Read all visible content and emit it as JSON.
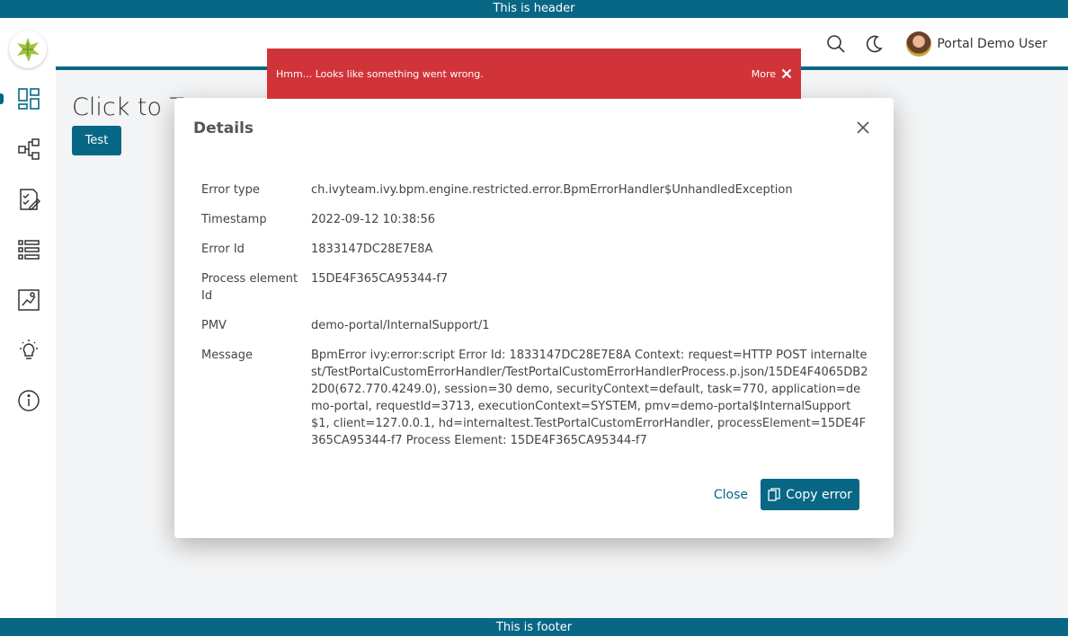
{
  "banners": {
    "header": "This is header",
    "footer": "This is footer"
  },
  "topbar": {
    "user_name": "Portal Demo User"
  },
  "main": {
    "title": "Click to T",
    "test_button": "Test"
  },
  "growl": {
    "message": "Hmm... Looks like something went wrong.",
    "more_label": "More"
  },
  "dialog": {
    "title": "Details",
    "rows": [
      {
        "label": "Error type",
        "value": "ch.ivyteam.ivy.bpm.engine.restricted.error.BpmErrorHandler$UnhandledException"
      },
      {
        "label": "Timestamp",
        "value": "2022-09-12 10:38:56"
      },
      {
        "label": "Error Id",
        "value": "1833147DC28E7E8A"
      },
      {
        "label": "Process element Id",
        "value": "15DE4F365CA95344-f7"
      },
      {
        "label": "PMV",
        "value": "demo-portal/InternalSupport/1"
      },
      {
        "label": "Message",
        "value": "BpmError ivy:error:script Error Id: 1833147DC28E7E8A Context: request=HTTP POST internaltest/TestPortalCustomErrorHandler/TestPortalCustomErrorHandlerProcess.p.json/15DE4F4065DB22D0(672.770.4249.0), session=30 demo, securityContext=default, task=770, application=demo-portal, requestId=3713, executionContext=SYSTEM, pmv=demo-portal$InternalSupport$1, client=127.0.0.1, hd=internaltest.TestPortalCustomErrorHandler, processElement=15DE4F365CA95344-f7 Process Element: 15DE4F365CA95344-f7"
      }
    ],
    "close_label": "Close",
    "copy_label": "Copy error"
  },
  "colors": {
    "primary": "#076785",
    "error": "#d13438"
  },
  "icons": [
    "ivy-logo-icon",
    "dashboard-icon",
    "process-icon",
    "task-icon",
    "case-list-icon",
    "statistics-icon",
    "idea-icon",
    "info-icon",
    "search-icon",
    "moon-icon",
    "close-icon",
    "copy-icon"
  ]
}
